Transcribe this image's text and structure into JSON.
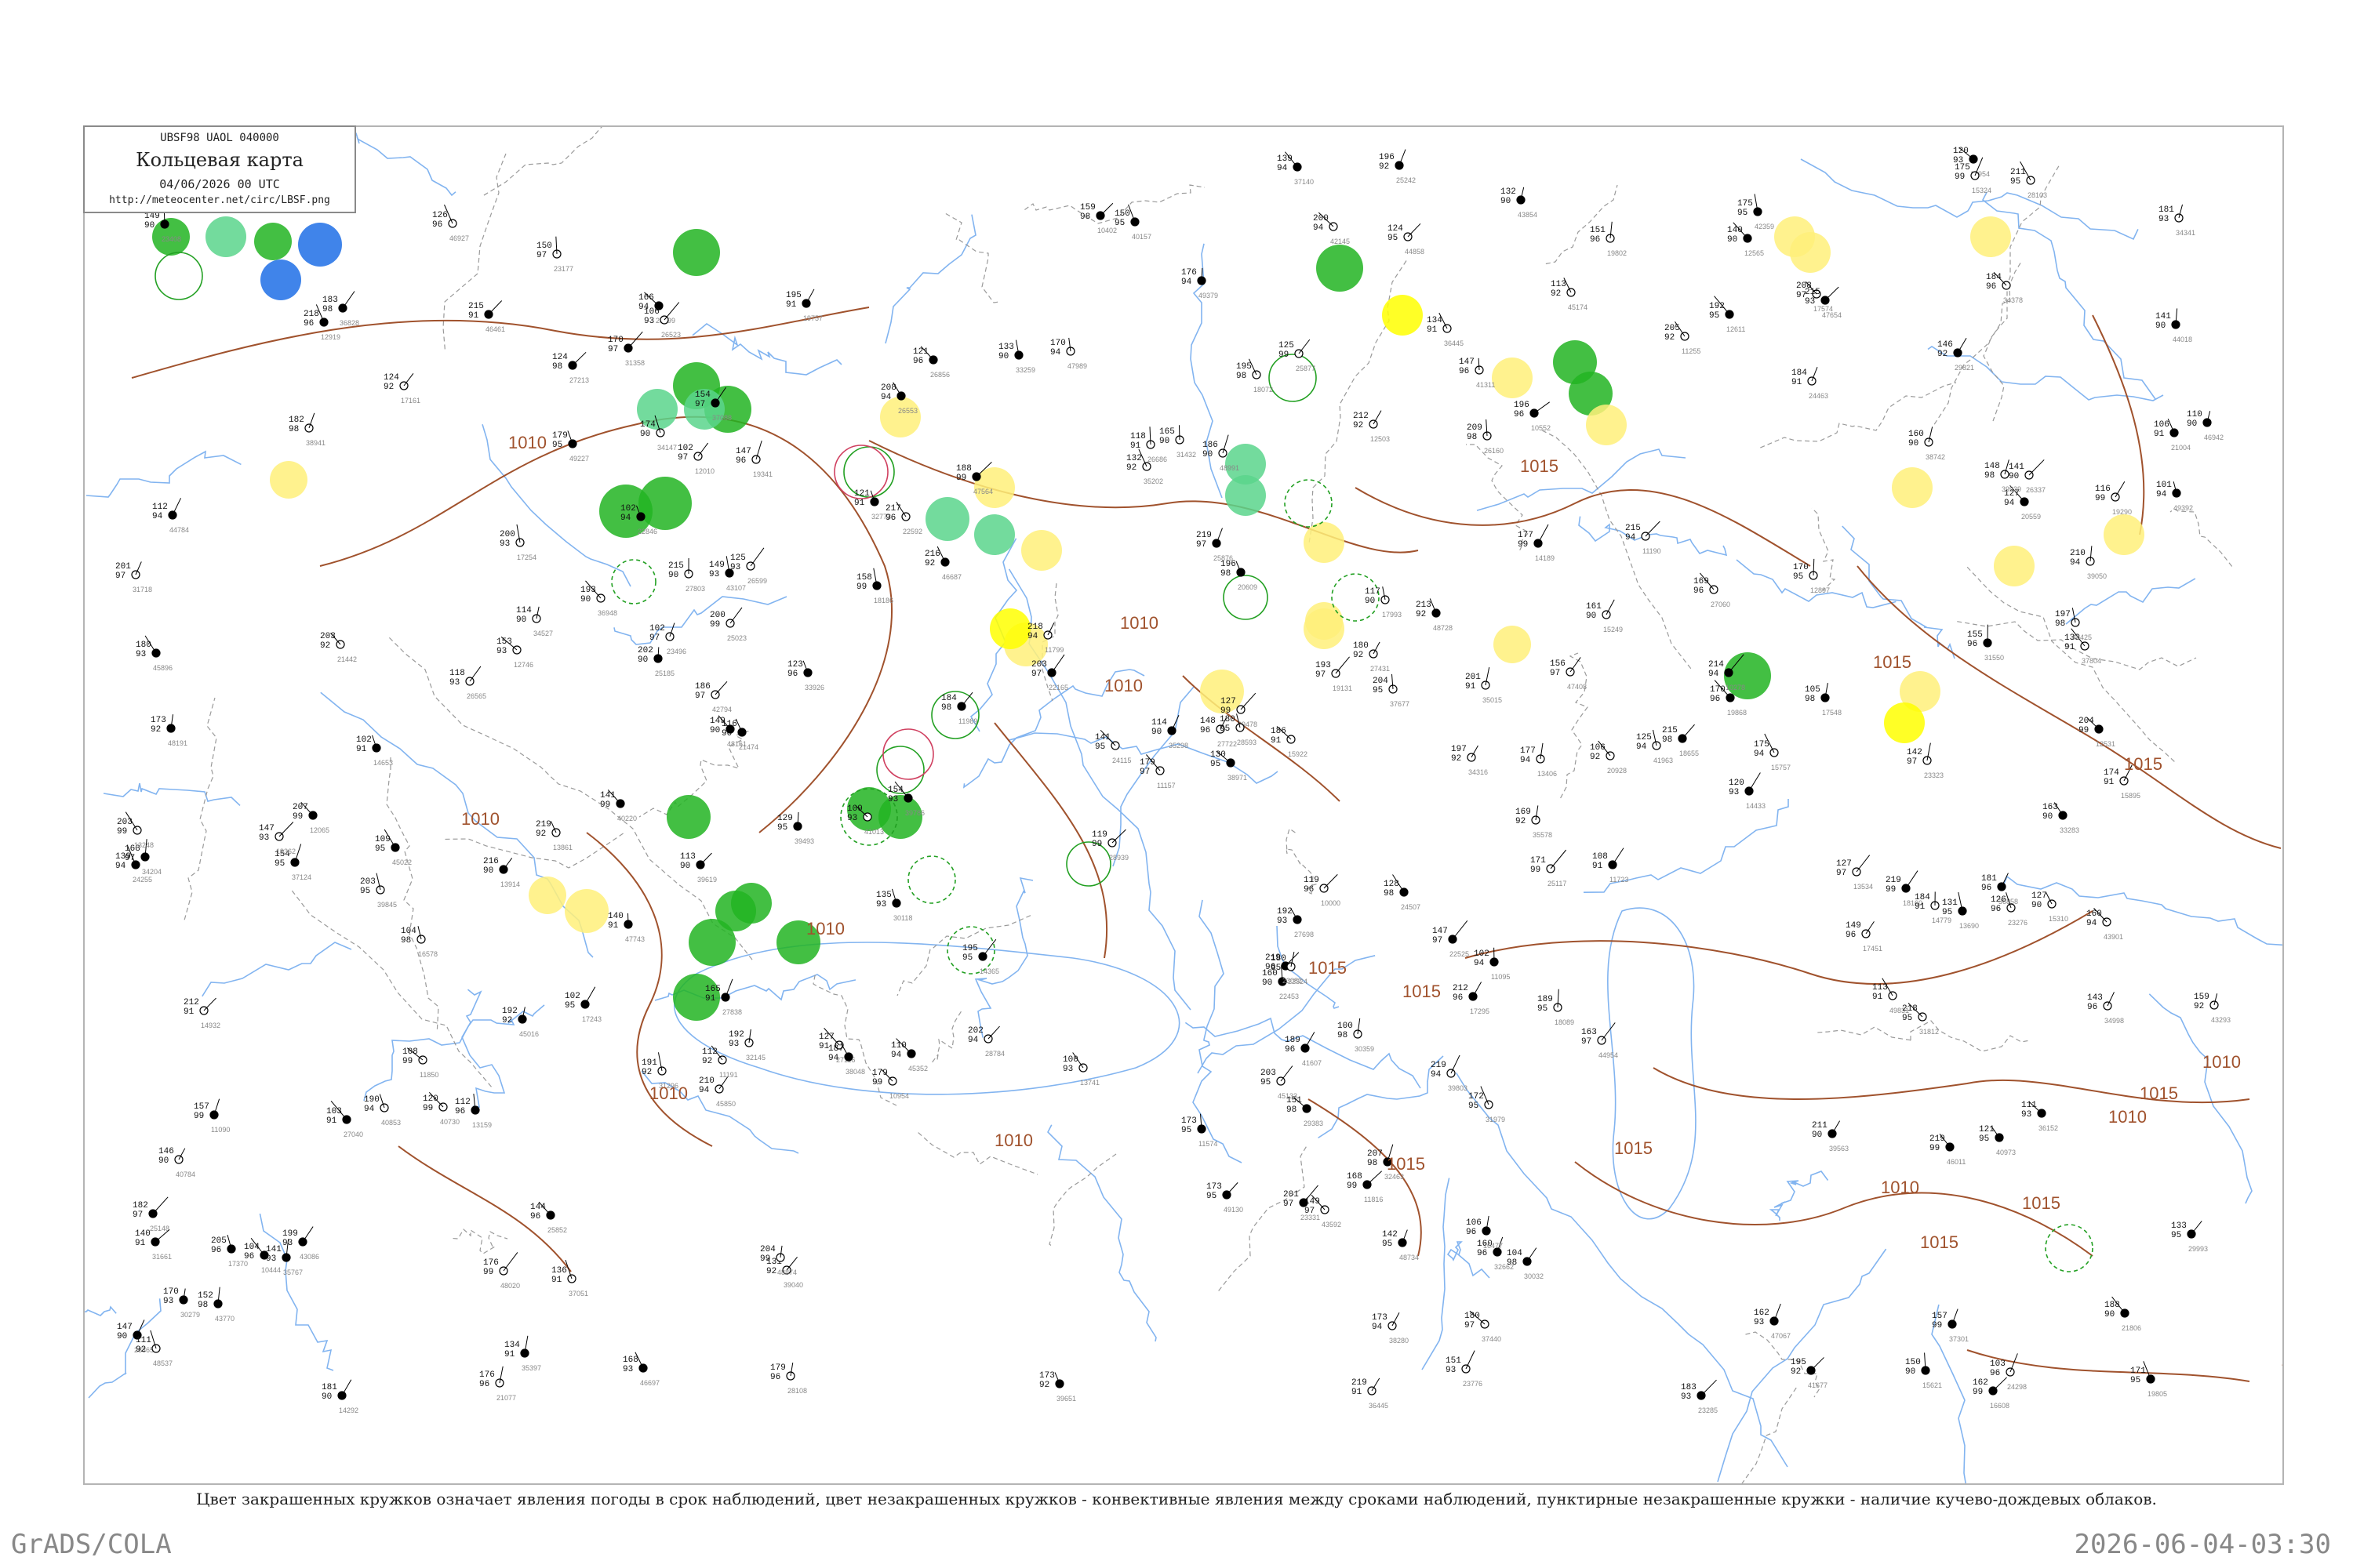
{
  "header": {
    "code": "UBSF98  UAOL  040000",
    "title": "Кольцевая карта",
    "time": "04/06/2026 00 UTC",
    "url": "http://meteocenter.net/circ/LBSF.png"
  },
  "caption": "Цвет закрашенных кружков означает явления погоды в срок наблюдений, цвет незакрашенных кружков - конвективные явления между сроками наблюдений, пунктирные незакрашенные кружки - наличие кучево-дождевых облаков.",
  "footer": {
    "left": "GrADS/COLA",
    "right": "2026-06-04-03:30"
  },
  "colors": {
    "rain_light": "#a6e3a6",
    "rain": "#22b422",
    "rain_moderate": "#0aa00a",
    "shower": "#5ad58c",
    "fog_haze": "#fff07a",
    "thunder": "#ffff00",
    "snow": "#1e6ee6",
    "isobar": "#a0522d",
    "river": "#82b4f0",
    "border": "#9a9a9a"
  },
  "isobar_labels": [
    "1010",
    "1015",
    "1010",
    "1015",
    "1010",
    "1015",
    "1010",
    "1015",
    "1010",
    "1015",
    "1010",
    "1015",
    "1010",
    "1015",
    "1010",
    "1015",
    "1010",
    "1010",
    "1015",
    "1015",
    "10"
  ],
  "stations": [
    {
      "id": "bucharest",
      "pres": "140",
      "temp": "97",
      "dew": "89"
    },
    {
      "id": "bursa",
      "pres": "143",
      "temp": "96",
      "dew": "103"
    },
    {
      "id": "athens",
      "pres": "186",
      "temp": "97",
      "dew": "103"
    },
    {
      "id": "sofia",
      "pres": "149",
      "temp": "96",
      "dew": "124"
    },
    {
      "id": "kharkiv",
      "pres": "164",
      "temp": "96",
      "dew": "109"
    },
    {
      "id": "rostov",
      "pres": "137",
      "temp": "96",
      "dew": "153"
    },
    {
      "id": "samara",
      "pres": "116",
      "temp": "96",
      "dew": "100"
    },
    {
      "id": "orenburg",
      "pres": "178",
      "temp": "97",
      "dew": "175"
    }
  ],
  "weather_circles": [
    {
      "kind": "rain_moderate",
      "fill": true
    },
    {
      "kind": "rain",
      "fill": true
    },
    {
      "kind": "shower",
      "fill": true
    },
    {
      "kind": "fog_haze",
      "fill": true
    },
    {
      "kind": "thunder",
      "fill": true
    },
    {
      "kind": "snow",
      "fill": true
    },
    {
      "kind": "rain",
      "fill": false
    },
    {
      "kind": "thunder",
      "fill": false
    },
    {
      "kind": "cb",
      "fill": false
    }
  ]
}
